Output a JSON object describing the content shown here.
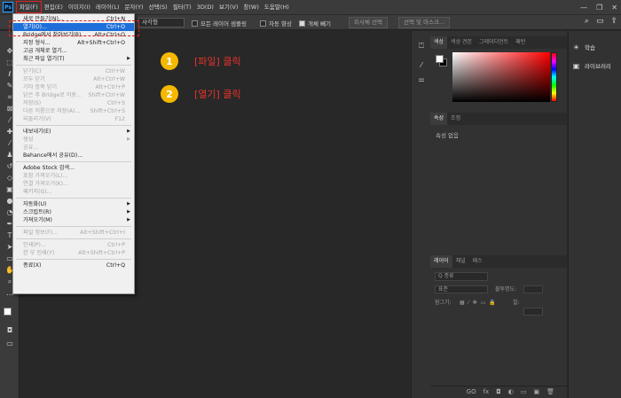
{
  "app": {
    "logo": "Ps"
  },
  "menubar": {
    "items": [
      "파일(F)",
      "편집(E)",
      "이미지(I)",
      "레이어(L)",
      "문자(Y)",
      "선택(S)",
      "필터(T)",
      "3D(D)",
      "보기(V)",
      "창(W)",
      "도움말(H)"
    ],
    "window_controls": [
      "—",
      "❐",
      "✕"
    ]
  },
  "optbar": {
    "shape_select": "사각형",
    "sample_all_layers": "모든 레이어 샘플링",
    "auto_enhance": "자동 향상",
    "object_subtract": "개체 빼기",
    "select_subject": "피사체 선택",
    "select_and_mask": "선택 및 마스크..."
  },
  "file_menu": {
    "items": [
      {
        "label": "새로 만들기(N)...",
        "shortcut": "Ctrl+N",
        "disabled": false
      },
      {
        "label": "열기(O)...",
        "shortcut": "Ctrl+O",
        "disabled": false,
        "highlight": true
      },
      {
        "label": "Bridge에서 찾아보기(B)...",
        "shortcut": "Alt+Ctrl+O",
        "disabled": false
      },
      {
        "label": "지정 형식...",
        "shortcut": "Alt+Shift+Ctrl+O",
        "disabled": false
      },
      {
        "label": "고급 개체로 열기...",
        "shortcut": "",
        "disabled": false
      },
      {
        "label": "최근 파일 열기(T)",
        "shortcut": "",
        "arrow": true,
        "disabled": false
      },
      {
        "sep": true
      },
      {
        "label": "닫기(C)",
        "shortcut": "Ctrl+W",
        "disabled": true
      },
      {
        "label": "모두 닫기",
        "shortcut": "Alt+Ctrl+W",
        "disabled": true
      },
      {
        "label": "기타 항목 닫기",
        "shortcut": "Alt+Ctrl+P",
        "disabled": true
      },
      {
        "label": "닫은 후 Bridge로 이동...",
        "shortcut": "Shift+Ctrl+W",
        "disabled": true
      },
      {
        "label": "저장(S)",
        "shortcut": "Ctrl+S",
        "disabled": true
      },
      {
        "label": "다른 이름으로 저장(A)...",
        "shortcut": "Shift+Ctrl+S",
        "disabled": true
      },
      {
        "label": "되돌리기(V)",
        "shortcut": "F12",
        "disabled": true
      },
      {
        "sep": true
      },
      {
        "label": "내보내기(E)",
        "shortcut": "",
        "arrow": true,
        "disabled": false
      },
      {
        "label": "생성",
        "shortcut": "",
        "arrow": true,
        "disabled": true
      },
      {
        "label": "공유...",
        "shortcut": "",
        "disabled": true
      },
      {
        "label": "Behance에서 공유(D)...",
        "shortcut": "",
        "disabled": false
      },
      {
        "sep": true
      },
      {
        "label": "Adobe Stock 검색...",
        "shortcut": "",
        "disabled": false
      },
      {
        "label": "포함 가져오기(L)...",
        "shortcut": "",
        "disabled": true
      },
      {
        "label": "연결 가져오기(K)...",
        "shortcut": "",
        "disabled": true
      },
      {
        "label": "패키지(G)...",
        "shortcut": "",
        "disabled": true
      },
      {
        "sep": true
      },
      {
        "label": "자동화(U)",
        "shortcut": "",
        "arrow": true,
        "disabled": false
      },
      {
        "label": "스크립트(R)",
        "shortcut": "",
        "arrow": true,
        "disabled": false
      },
      {
        "label": "가져오기(M)",
        "shortcut": "",
        "arrow": true,
        "disabled": false
      },
      {
        "sep": true
      },
      {
        "label": "파일 정보(F)...",
        "shortcut": "Alt+Shift+Ctrl+I",
        "disabled": true
      },
      {
        "sep": true
      },
      {
        "label": "인쇄(P)...",
        "shortcut": "Ctrl+P",
        "disabled": true
      },
      {
        "label": "한 부 인쇄(Y)",
        "shortcut": "Alt+Shift+Ctrl+P",
        "disabled": true
      },
      {
        "sep": true
      },
      {
        "label": "종료(X)",
        "shortcut": "Ctrl+Q",
        "disabled": false
      }
    ]
  },
  "callouts": [
    {
      "num": "1",
      "text": "[파일] 클릭"
    },
    {
      "num": "2",
      "text": "[열기] 클릭"
    }
  ],
  "color_panel": {
    "tabs": [
      "색상",
      "색상 견본",
      "그레이디언트",
      "패턴"
    ]
  },
  "properties_panel": {
    "tabs": [
      "속성",
      "조정"
    ],
    "empty_text": "속성 없음"
  },
  "layers_panel": {
    "tabs": [
      "레이어",
      "채널",
      "패스"
    ],
    "search_label": "Q 종류",
    "blend_mode": "표준",
    "opacity_label": "불투명도:",
    "lock_label": "잠그기:",
    "fill_label": "칠:",
    "footer_icons": [
      "GO",
      "fx",
      "◘",
      "◐",
      "▭",
      "▣",
      "🗑"
    ]
  },
  "far_right": {
    "items": [
      "학습",
      "라이브러리"
    ]
  },
  "colors": {
    "accent_red": "#e02020",
    "callout_yellow": "#f5b800",
    "callout_text": "#e8322b",
    "highlight_blue": "#1e6fd9"
  }
}
